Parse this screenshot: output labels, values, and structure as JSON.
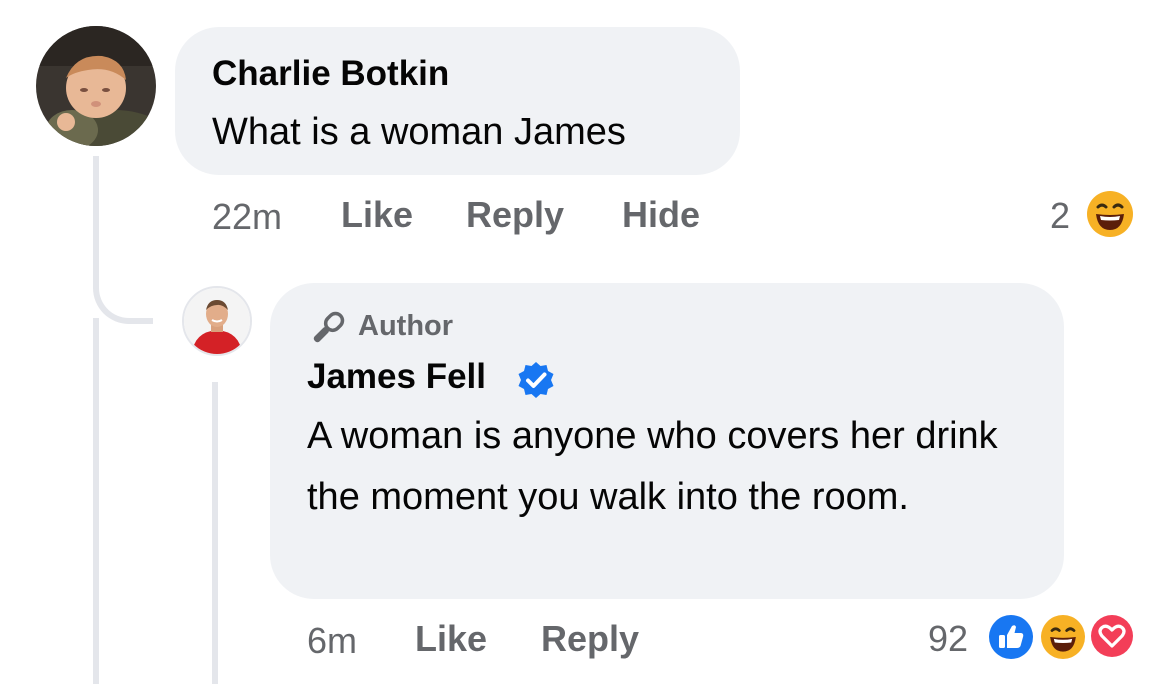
{
  "comment": {
    "author": "Charlie Botkin",
    "text": "What is a woman James",
    "time": "22m",
    "like_label": "Like",
    "reply_label": "Reply",
    "hide_label": "Hide",
    "reaction_count": "2",
    "reaction_icons": [
      "haha-icon"
    ]
  },
  "reply": {
    "badge": "Author",
    "badge_icon": "microphone-icon",
    "author": "James Fell",
    "verified_icon": "verified-badge-icon",
    "text": "A woman is anyone who covers her drink the moment you walk into the room.",
    "time": "6m",
    "like_label": "Like",
    "reply_label": "Reply",
    "reaction_count": "92",
    "reaction_icons": [
      "like-icon",
      "haha-icon",
      "love-icon"
    ]
  },
  "colors": {
    "bubble": "#f0f2f5",
    "meta_text": "#65676b",
    "verified_blue": "#1877f2",
    "like_blue": "#1877f2",
    "haha_yellow": "#f7b125",
    "love_red": "#f33e58"
  }
}
